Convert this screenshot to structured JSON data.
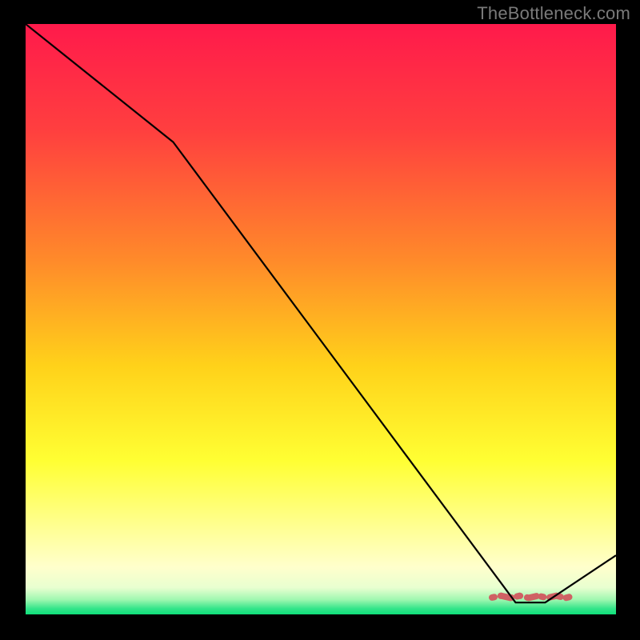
{
  "watermark": "TheBottleneck.com",
  "chart_data": {
    "type": "line",
    "title": "",
    "xlabel": "",
    "ylabel": "",
    "ylim": [
      0,
      100
    ],
    "x": [
      0,
      25,
      83,
      88,
      100
    ],
    "series": [
      {
        "name": "curve",
        "values": [
          100,
          80,
          2,
          2,
          10
        ]
      }
    ],
    "annotations": [
      {
        "name": "marker-band",
        "x_start": 79,
        "x_end": 93,
        "y": 3
      }
    ],
    "gradient_stops": [
      {
        "offset": 0.0,
        "color": "#ff1a4b"
      },
      {
        "offset": 0.18,
        "color": "#ff3f3f"
      },
      {
        "offset": 0.4,
        "color": "#ff8a2a"
      },
      {
        "offset": 0.58,
        "color": "#ffd21a"
      },
      {
        "offset": 0.74,
        "color": "#ffff33"
      },
      {
        "offset": 0.86,
        "color": "#ffff99"
      },
      {
        "offset": 0.92,
        "color": "#ffffcc"
      },
      {
        "offset": 0.955,
        "color": "#e8ffd0"
      },
      {
        "offset": 0.975,
        "color": "#9ff7b0"
      },
      {
        "offset": 0.99,
        "color": "#35e58a"
      },
      {
        "offset": 1.0,
        "color": "#0fe07a"
      }
    ],
    "marker_color": "#d1585f",
    "line_color": "#000000"
  }
}
